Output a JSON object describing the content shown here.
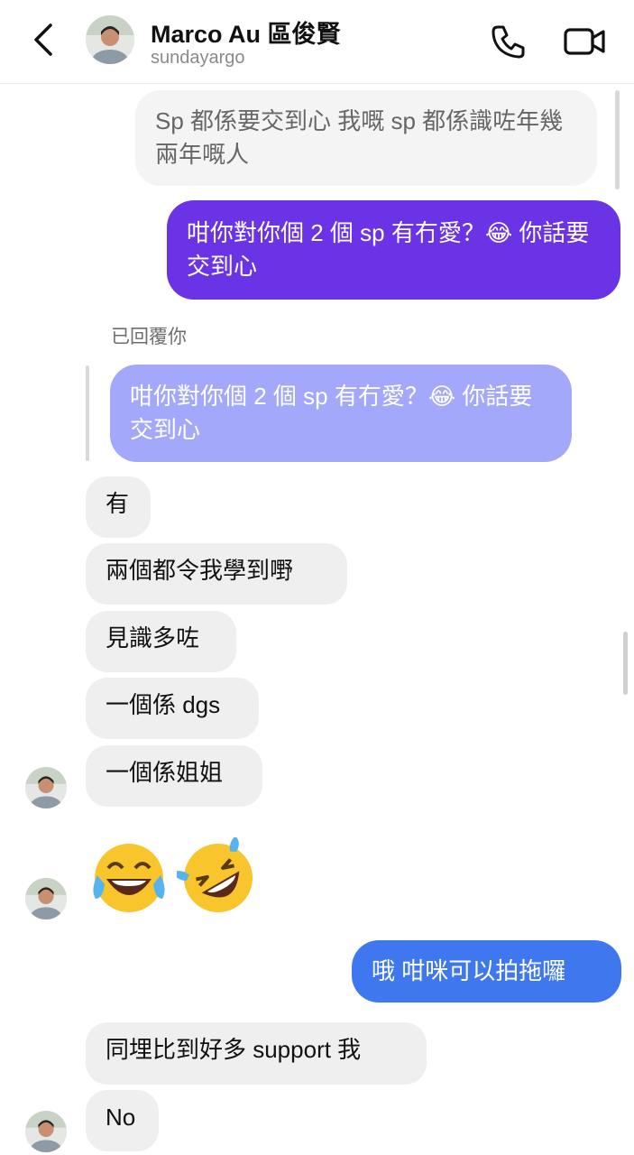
{
  "header": {
    "name": "Marco Au 區俊賢",
    "username": "sundayargo",
    "avatar_icon": "profile-photo-avatar",
    "call_icon": "phone-icon",
    "video_icon": "video-camera-icon"
  },
  "messages": {
    "m1": "Sp 都係要交到心 我嘅 sp 都係識咗年幾兩年嘅人",
    "m2": "咁你對你個 2 個 sp 有冇愛？😂 你話要交到心",
    "reply_label": "已回覆你",
    "quoted": "咁你對你個 2 個 sp 有冇愛？😂 你話要交到心",
    "m3": "有",
    "m4": "兩個都令我學到嘢",
    "m5": "見識多咗",
    "m6": "一個係 dgs",
    "m7": "一個係姐姐",
    "emoji_1": "😂",
    "emoji_2": "🤣",
    "m8": "哦 咁咪可以拍拖囉",
    "m9": "同埋比到好多 support 我",
    "m10": "No"
  },
  "colors": {
    "outgoing_purple": "#6b33e6",
    "outgoing_blue": "#3f78ee",
    "quoted_bubble": "#a3a8fb",
    "incoming": "#efefef"
  }
}
